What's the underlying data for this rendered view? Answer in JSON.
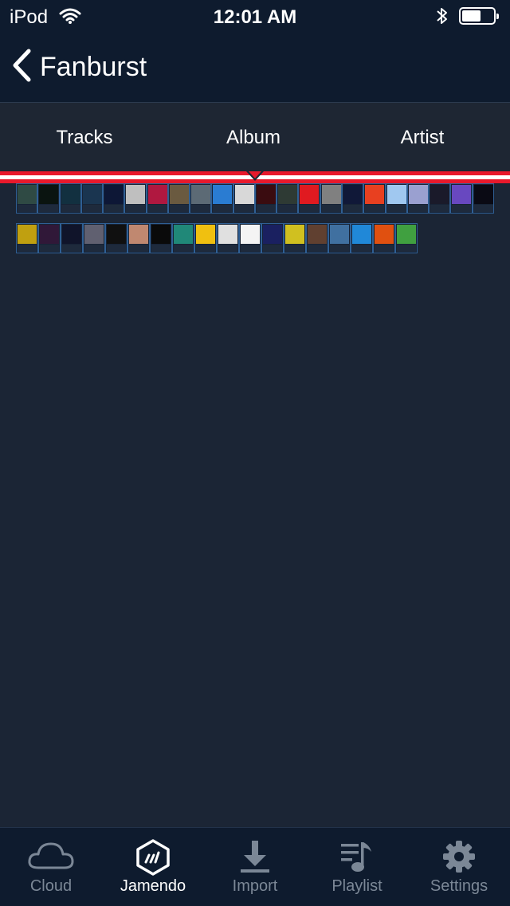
{
  "status_bar": {
    "carrier": "iPod",
    "time": "12:01 AM",
    "battery_level": 0.6
  },
  "nav": {
    "back_title": "Fanburst"
  },
  "tabs": [
    {
      "label": "Tracks"
    },
    {
      "label": "Album",
      "selected": true
    },
    {
      "label": "Artist"
    }
  ],
  "album_rows": [
    [
      "#2f4a44",
      "#0a1410",
      "#123040",
      "#1a3550",
      "#0d1736",
      "#bfbfbf",
      "#b01840",
      "#6a5a40",
      "#5c6a75",
      "#2a7cd2",
      "#d8d8d8",
      "#3a0c10",
      "#2e3a34",
      "#e01a20",
      "#808080",
      "#101838",
      "#e84020",
      "#a0c8f0",
      "#9aa0d0",
      "#1a1a2a",
      "#6848c0",
      "#0a0a14"
    ],
    [
      "#c0a010",
      "#301838",
      "#10142a",
      "#606070",
      "#101010",
      "#c08870",
      "#0a0a0a",
      "#208878",
      "#f0c010",
      "#e0e0e0",
      "#f4f4f4",
      "#1a2060",
      "#d0c020",
      "#604030",
      "#4070a0",
      "#2088d8",
      "#e05010",
      "#40a040"
    ]
  ],
  "bottom_tabs": [
    {
      "label": "Cloud",
      "icon": "cloud-icon"
    },
    {
      "label": "Jamendo",
      "icon": "jamendo-icon",
      "selected": true
    },
    {
      "label": "Import",
      "icon": "download-icon"
    },
    {
      "label": "Playlist",
      "icon": "playlist-icon"
    },
    {
      "label": "Settings",
      "icon": "gear-icon"
    }
  ],
  "colors": {
    "accent_red": "#e8192c",
    "background": "#1b2535",
    "bar": "#0e1b2e",
    "inactive": "#7b8796"
  }
}
